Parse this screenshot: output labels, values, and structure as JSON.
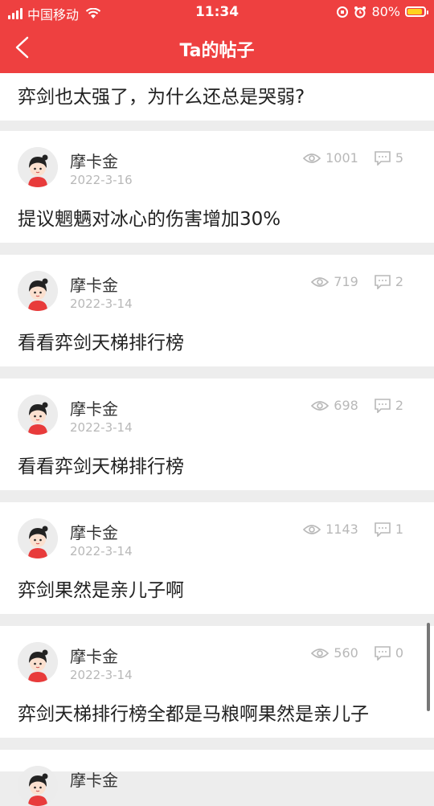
{
  "status": {
    "carrier": "中国移动",
    "time": "11:34",
    "battery_pct": "80%",
    "colors": {
      "bar": "#ee4040",
      "battery": "#ffd21f"
    }
  },
  "header": {
    "title": "Ta的帖子",
    "back_icon": "chevron-left-icon"
  },
  "first_post": {
    "title": "弈剑也太强了，为什么还总是哭弱?"
  },
  "posts": [
    {
      "author": "摩卡金",
      "date": "2022-3-16",
      "views": "1001",
      "comments": "5",
      "title": "提议魍魉对冰心的伤害增加30%"
    },
    {
      "author": "摩卡金",
      "date": "2022-3-14",
      "views": "719",
      "comments": "2",
      "title": "看看弈剑天梯排行榜"
    },
    {
      "author": "摩卡金",
      "date": "2022-3-14",
      "views": "698",
      "comments": "2",
      "title": "看看弈剑天梯排行榜"
    },
    {
      "author": "摩卡金",
      "date": "2022-3-14",
      "views": "1143",
      "comments": "1",
      "title": "弈剑果然是亲儿子啊"
    },
    {
      "author": "摩卡金",
      "date": "2022-3-14",
      "views": "560",
      "comments": "0",
      "title": "弈剑天梯排行榜全都是马粮啊果然是亲儿子"
    }
  ],
  "next_post": {
    "author": "摩卡金"
  }
}
